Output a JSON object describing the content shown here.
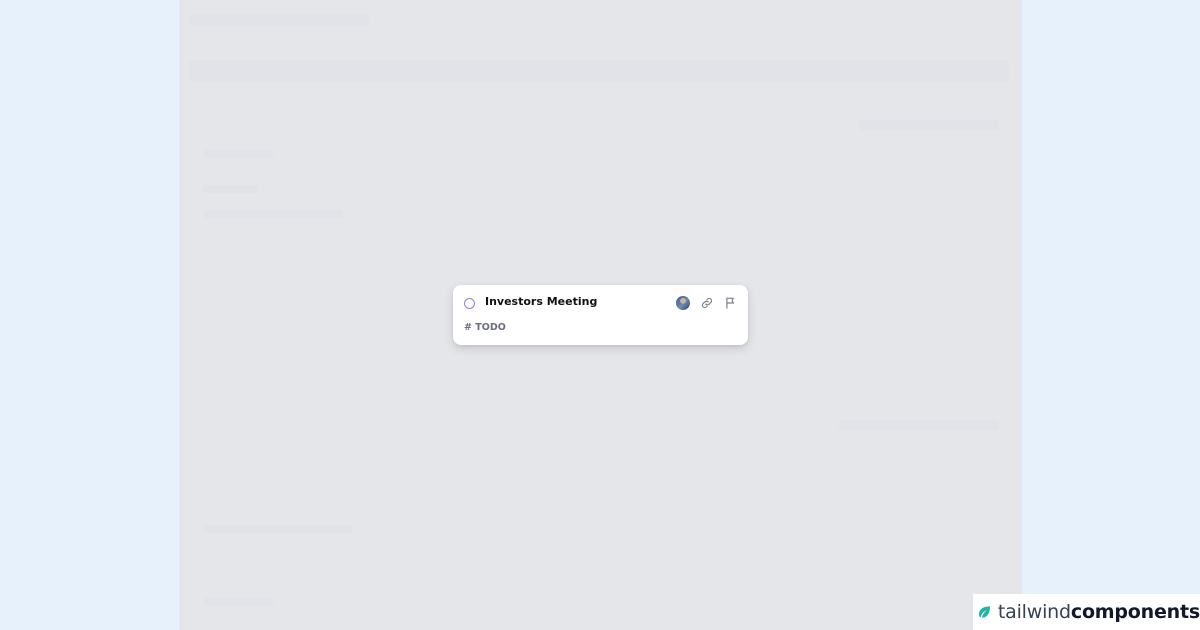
{
  "card": {
    "title": "Investors Meeting",
    "tag": "# TODO",
    "status_icon": "circle-outline-icon",
    "actions": [
      "avatar",
      "link-icon",
      "flag-icon"
    ]
  },
  "brand": {
    "name_light": "tailwind",
    "name_bold": "components",
    "logo_icon": "leaf-icon"
  },
  "colors": {
    "page_bg": "#e7f1fb",
    "stage_bg": "#e5e6ea",
    "checkbox_border": "#8b82e0",
    "brand_accent": "#1fb6a6"
  }
}
